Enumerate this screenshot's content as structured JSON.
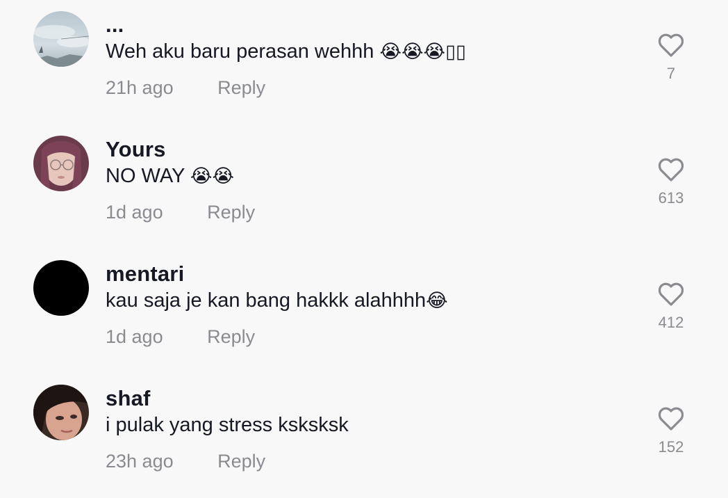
{
  "comments": [
    {
      "username": "...",
      "text": "Weh aku baru perasan wehhh ",
      "emojis": "😭😭😭▯▯",
      "time": "21h ago",
      "reply_label": "Reply",
      "likes": "7"
    },
    {
      "username": "Yours",
      "text": "NO WAY ",
      "emojis": "😭😭",
      "time": "1d ago",
      "reply_label": "Reply",
      "likes": "613"
    },
    {
      "username": "mentari",
      "text": "kau saja je kan bang hakkk alahhhh",
      "emojis": "😂",
      "time": "1d ago",
      "reply_label": "Reply",
      "likes": "412"
    },
    {
      "username": "shaf",
      "text": "i pulak yang stress ksksksk",
      "emojis": "",
      "time": "23h ago",
      "reply_label": "Reply",
      "likes": "152"
    }
  ],
  "icons": {
    "like": "heart-outline-icon"
  },
  "colors": {
    "background": "#f8f8f8",
    "text_primary": "#161823",
    "text_secondary": "#8a8b91"
  }
}
